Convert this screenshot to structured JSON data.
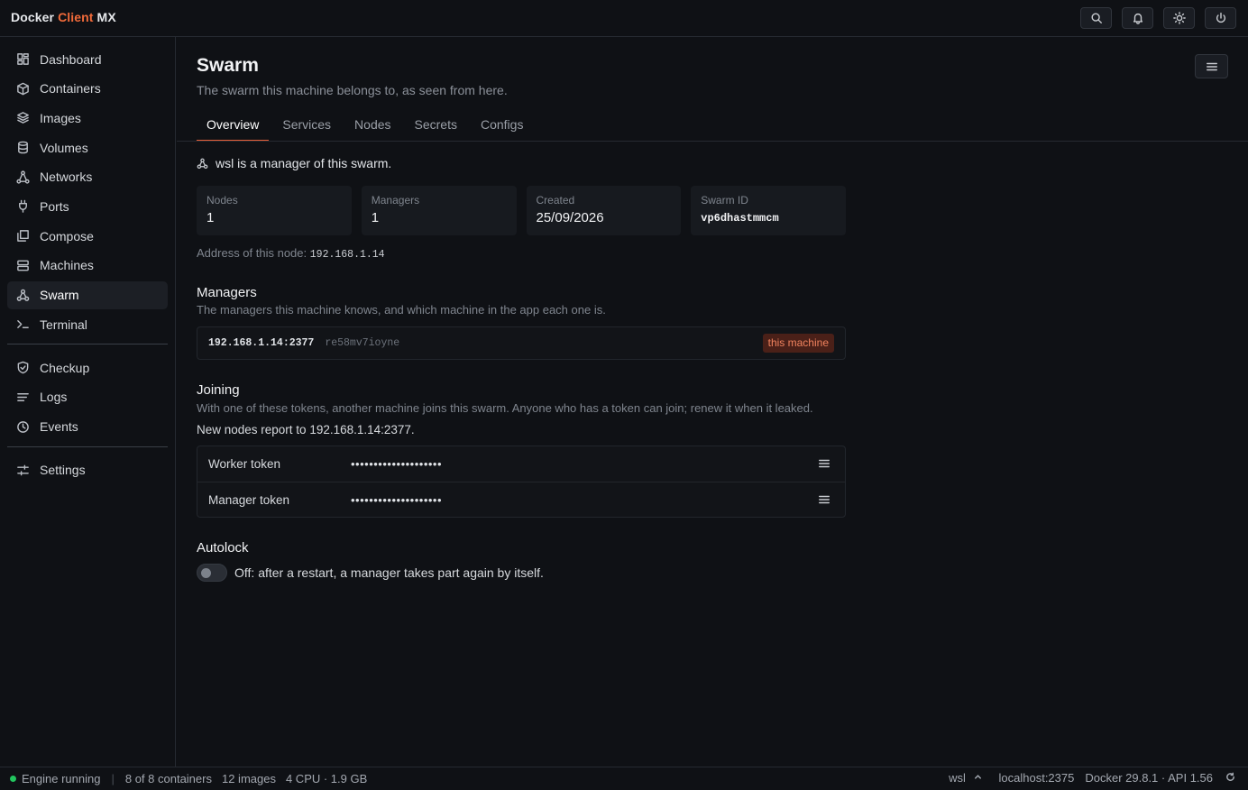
{
  "app": {
    "brand_prefix": "Docker ",
    "brand_accent": "Client",
    "brand_suffix": " MX",
    "accent_color": "#f26b3a"
  },
  "topbar": {
    "icons": [
      "search-icon",
      "bell-icon",
      "sun-icon",
      "power-icon"
    ]
  },
  "sidebar": {
    "items": [
      {
        "label": "Dashboard",
        "icon": "dashboard-icon"
      },
      {
        "label": "Containers",
        "icon": "box-icon"
      },
      {
        "label": "Images",
        "icon": "layers-icon"
      },
      {
        "label": "Volumes",
        "icon": "database-icon"
      },
      {
        "label": "Networks",
        "icon": "network-icon"
      },
      {
        "label": "Ports",
        "icon": "plug-icon"
      },
      {
        "label": "Compose",
        "icon": "copy-icon"
      },
      {
        "label": "Machines",
        "icon": "server-icon"
      },
      {
        "label": "Swarm",
        "icon": "swarm-icon",
        "active": true
      },
      {
        "label": "Terminal",
        "icon": "terminal-icon"
      },
      {
        "label": "Checkup",
        "icon": "shield-check-icon"
      },
      {
        "label": "Logs",
        "icon": "lines-icon"
      },
      {
        "label": "Events",
        "icon": "clock-icon"
      },
      {
        "label": "Settings",
        "icon": "sliders-icon"
      }
    ]
  },
  "page": {
    "title": "Swarm",
    "subtitle": "The swarm this machine belongs to, as seen from here.",
    "tabs": [
      "Overview",
      "Services",
      "Nodes",
      "Secrets",
      "Configs"
    ],
    "active_tab": "Overview"
  },
  "overview": {
    "role_text": "wsl is a manager of this swarm.",
    "stats": {
      "nodes_label": "Nodes",
      "nodes_value": "1",
      "managers_label": "Managers",
      "managers_value": "1",
      "created_label": "Created",
      "created_value": "25/09/2026",
      "swarm_id_label": "Swarm ID",
      "swarm_id_value": "vp6dhastmmcm"
    },
    "address_label": "Address of this node:",
    "address_value": "192.168.1.14"
  },
  "managers": {
    "title": "Managers",
    "subtitle": "The managers this machine knows, and which machine in the app each one is.",
    "rows": [
      {
        "address": "192.168.1.14:2377",
        "id": "re58mv7ioyne",
        "badge": "this machine"
      }
    ]
  },
  "joining": {
    "title": "Joining",
    "subtitle": "With one of these tokens, another machine joins this swarm. Anyone who has a token can join; renew it when it leaked.",
    "report": "New nodes report to 192.168.1.14:2377.",
    "tokens": [
      {
        "label": "Worker token",
        "value": "••••••••••••••••••••"
      },
      {
        "label": "Manager token",
        "value": "••••••••••••••••••••"
      }
    ]
  },
  "autolock": {
    "title": "Autolock",
    "enabled": false,
    "text": "Off: after a restart, a manager takes part again by itself."
  },
  "statusbar": {
    "engine": "Engine running",
    "engine_color": "#22c55e",
    "containers": "8 of 8 containers",
    "images": "12 images",
    "resources": "4 CPU · 1.9 GB",
    "context": "wsl",
    "host": "localhost:2375",
    "version": "Docker 29.8.1 · API 1.56"
  }
}
